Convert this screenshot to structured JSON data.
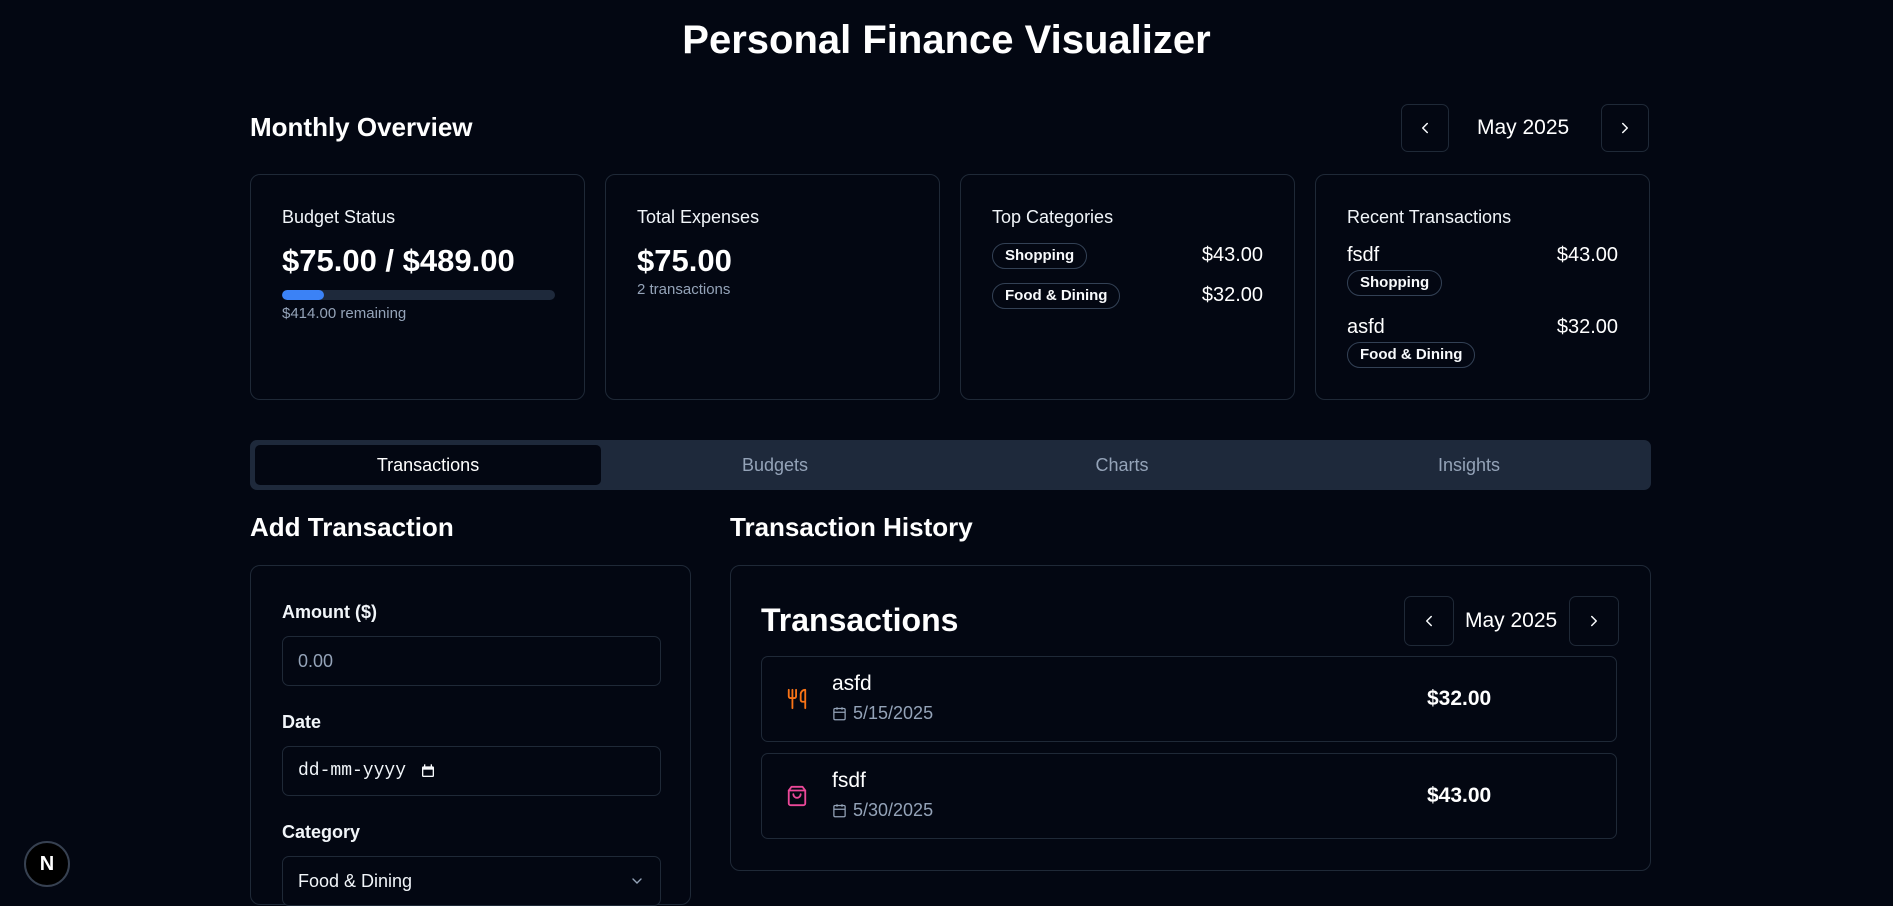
{
  "app": {
    "title": "Personal Finance Visualizer"
  },
  "overview": {
    "heading": "Monthly Overview",
    "month": "May 2025",
    "prev_icon": "chevron-left-icon",
    "next_icon": "chevron-right-icon"
  },
  "cards": {
    "budget": {
      "title": "Budget Status",
      "value": "$75.00 / $489.00",
      "remaining": "$414.00 remaining",
      "progress": 0.153,
      "accent": "#3b82f6"
    },
    "expenses": {
      "title": "Total Expenses",
      "value": "$75.00",
      "count": "2 transactions"
    },
    "top_categories": {
      "title": "Top Categories",
      "items": [
        {
          "category": "Shopping",
          "amount": "$43.00"
        },
        {
          "category": "Food & Dining",
          "amount": "$32.00"
        }
      ]
    },
    "recent": {
      "title": "Recent Transactions",
      "items": [
        {
          "name": "fsdf",
          "amount": "$43.00",
          "category": "Shopping"
        },
        {
          "name": "asfd",
          "amount": "$32.00",
          "category": "Food & Dining"
        }
      ]
    }
  },
  "tabs": [
    {
      "label": "Transactions",
      "active": true
    },
    {
      "label": "Budgets",
      "active": false
    },
    {
      "label": "Charts",
      "active": false
    },
    {
      "label": "Insights",
      "active": false
    }
  ],
  "add_form": {
    "heading": "Add Transaction",
    "amount_label": "Amount ($)",
    "amount_placeholder": "0.00",
    "date_label": "Date",
    "date_placeholder": "dd-mm-yyyy",
    "category_label": "Category",
    "category_value": "Food & Dining"
  },
  "history": {
    "heading": "Transaction History",
    "panel_title": "Transactions",
    "month": "May 2025",
    "rows": [
      {
        "name": "asfd",
        "date": "5/15/2025",
        "amount": "$32.00",
        "icon": "utensils-icon",
        "color": "#f97316"
      },
      {
        "name": "fsdf",
        "date": "5/30/2025",
        "amount": "$43.00",
        "icon": "shopping-bag-icon",
        "color": "#ec4899"
      }
    ]
  },
  "fab": {
    "label": "N"
  }
}
